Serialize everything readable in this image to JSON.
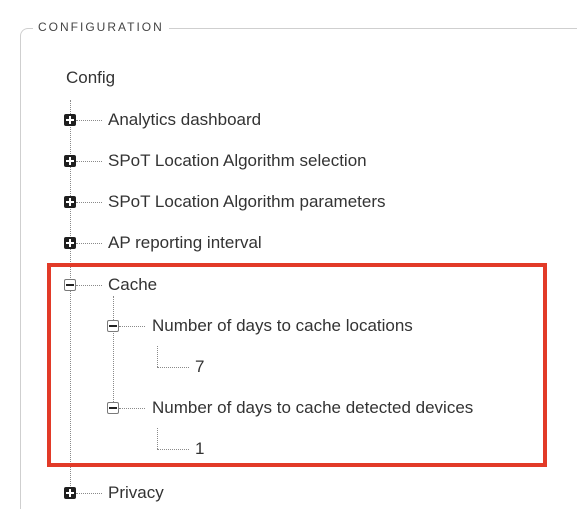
{
  "fieldset": {
    "legend": "CONFIGURATION"
  },
  "tree": {
    "root_label": "Config",
    "items": [
      {
        "label": "Analytics dashboard",
        "state": "collapsed"
      },
      {
        "label": "SPoT Location Algorithm selection",
        "state": "collapsed"
      },
      {
        "label": "SPoT Location Algorithm parameters",
        "state": "collapsed"
      },
      {
        "label": "AP reporting interval",
        "state": "collapsed"
      },
      {
        "label": "Cache",
        "state": "expanded",
        "children": [
          {
            "label": "Number of days to cache locations",
            "state": "expanded",
            "value": "7"
          },
          {
            "label": "Number of days to cache detected devices",
            "state": "expanded",
            "value": "1"
          }
        ]
      },
      {
        "label": "Privacy",
        "state": "collapsed"
      }
    ]
  },
  "highlight": {
    "color": "#e23a28"
  }
}
